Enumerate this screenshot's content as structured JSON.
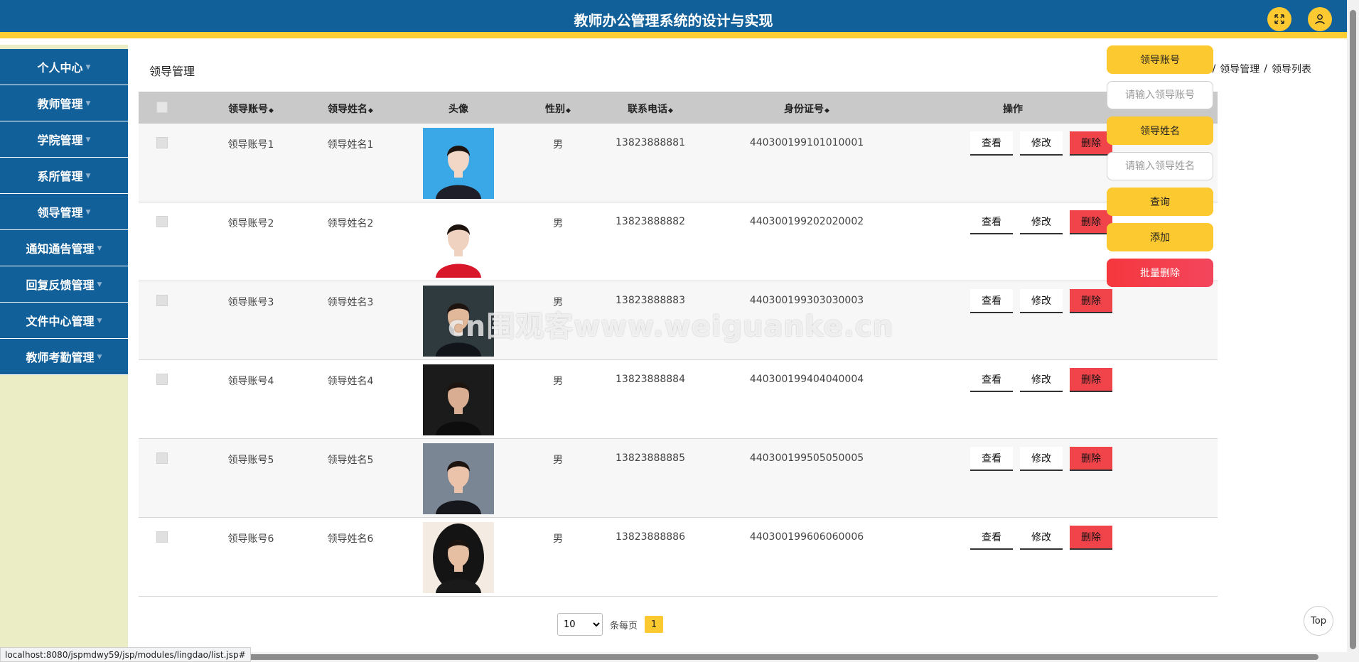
{
  "header": {
    "title": "教师办公管理系统的设计与实现"
  },
  "sidebar": {
    "items": [
      {
        "label": "个人中心"
      },
      {
        "label": "教师管理"
      },
      {
        "label": "学院管理"
      },
      {
        "label": "系所管理"
      },
      {
        "label": "领导管理"
      },
      {
        "label": "通知通告管理"
      },
      {
        "label": "回复反馈管理"
      },
      {
        "label": "文件中心管理"
      },
      {
        "label": "教师考勤管理"
      }
    ]
  },
  "main": {
    "page_title": "领导管理",
    "breadcrumb": {
      "parent": "领导管理",
      "sep": "/",
      "current": "领导列表"
    }
  },
  "table": {
    "headers": {
      "account": "领导账号",
      "name": "领导姓名",
      "avatar": "头像",
      "sex": "性别",
      "phone": "联系电话",
      "id_no": "身份证号",
      "ops": "操作"
    },
    "rows": [
      {
        "account": "领导账号1",
        "name": "领导姓名1",
        "sex": "男",
        "phone": "13823888881",
        "id_no": "440300199101010001"
      },
      {
        "account": "领导账号2",
        "name": "领导姓名2",
        "sex": "男",
        "phone": "13823888882",
        "id_no": "440300199202020002"
      },
      {
        "account": "领导账号3",
        "name": "领导姓名3",
        "sex": "男",
        "phone": "13823888883",
        "id_no": "440300199303030003"
      },
      {
        "account": "领导账号4",
        "name": "领导姓名4",
        "sex": "男",
        "phone": "13823888884",
        "id_no": "440300199404040004"
      },
      {
        "account": "领导账号5",
        "name": "领导姓名5",
        "sex": "男",
        "phone": "13823888885",
        "id_no": "440300199505050005"
      },
      {
        "account": "领导账号6",
        "name": "领导姓名6",
        "sex": "男",
        "phone": "13823888886",
        "id_no": "440300199606060006"
      }
    ],
    "actions": {
      "view": "查看",
      "edit": "修改",
      "delete": "删除"
    }
  },
  "pagination": {
    "page_size": "10",
    "per_page_label": "条每页",
    "current_page": "1"
  },
  "search_panel": {
    "account_label": "领导账号",
    "account_placeholder": "请输入领导账号",
    "name_label": "领导姓名",
    "name_placeholder": "请输入领导姓名",
    "query_label": "查询",
    "add_label": "添加",
    "batch_delete_label": "批量删除"
  },
  "top_button": "Top",
  "watermark": "cn围观客www.weiguanke.cn",
  "status_url": "localhost:8080/jspmdwy59/jsp/modules/lingdao/list.jsp#",
  "colors": {
    "header_bg": "#12609a",
    "accent_yellow": "#fdc930",
    "danger_red": "#f1444a",
    "sidebar_bg": "#ebeec4"
  }
}
